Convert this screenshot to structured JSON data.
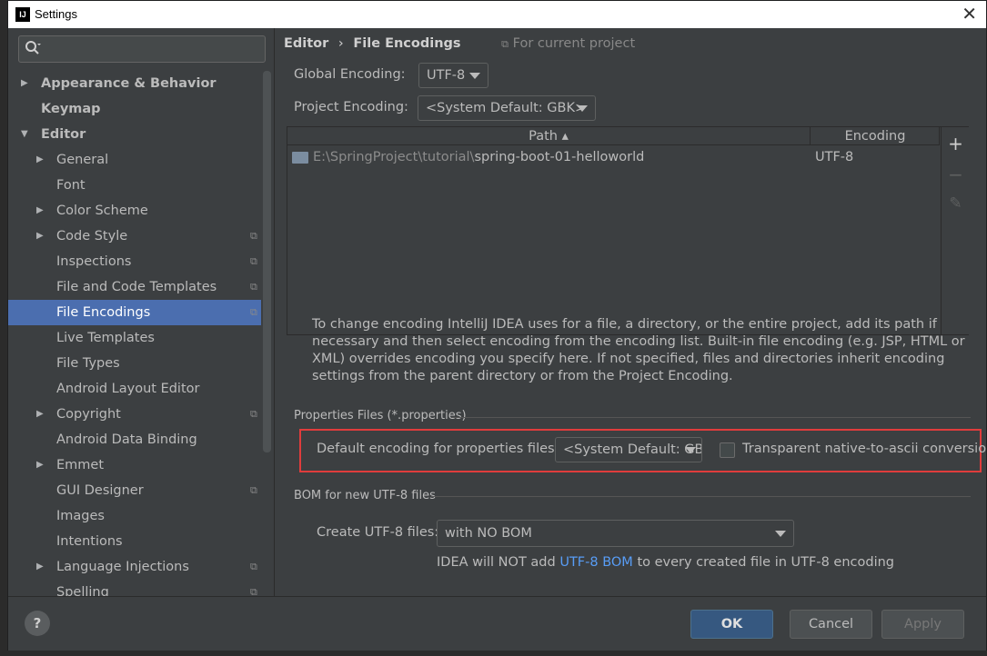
{
  "window": {
    "title": "Settings",
    "app_icon": "IJ",
    "close_glyph": "✕"
  },
  "sidebar": {
    "search_placeholder": "",
    "items": [
      {
        "label": "Appearance & Behavior",
        "arrow": "▶",
        "bold": true,
        "level": 0
      },
      {
        "label": "Keymap",
        "arrow": "",
        "bold": true,
        "level": 0
      },
      {
        "label": "Editor",
        "arrow": "▼",
        "bold": true,
        "level": 0
      },
      {
        "label": "General",
        "arrow": "▶",
        "level": 1
      },
      {
        "label": "Font",
        "arrow": "",
        "level": 1
      },
      {
        "label": "Color Scheme",
        "arrow": "▶",
        "level": 1
      },
      {
        "label": "Code Style",
        "arrow": "▶",
        "level": 1,
        "proj": true
      },
      {
        "label": "Inspections",
        "arrow": "",
        "level": 1,
        "proj": true
      },
      {
        "label": "File and Code Templates",
        "arrow": "",
        "level": 1,
        "proj": true
      },
      {
        "label": "File Encodings",
        "arrow": "",
        "level": 1,
        "proj": true,
        "selected": true
      },
      {
        "label": "Live Templates",
        "arrow": "",
        "level": 1
      },
      {
        "label": "File Types",
        "arrow": "",
        "level": 1
      },
      {
        "label": "Android Layout Editor",
        "arrow": "",
        "level": 1
      },
      {
        "label": "Copyright",
        "arrow": "▶",
        "level": 1,
        "proj": true
      },
      {
        "label": "Android Data Binding",
        "arrow": "",
        "level": 1
      },
      {
        "label": "Emmet",
        "arrow": "▶",
        "level": 1
      },
      {
        "label": "GUI Designer",
        "arrow": "",
        "level": 1,
        "proj": true
      },
      {
        "label": "Images",
        "arrow": "",
        "level": 1
      },
      {
        "label": "Intentions",
        "arrow": "",
        "level": 1
      },
      {
        "label": "Language Injections",
        "arrow": "▶",
        "level": 1,
        "proj": true
      },
      {
        "label": "Spelling",
        "arrow": "",
        "level": 1,
        "proj": true
      }
    ]
  },
  "breadcrumb": {
    "parent": "Editor",
    "sep": "›",
    "current": "File Encodings",
    "scope": "For current project"
  },
  "global_encoding": {
    "label": "Global Encoding:",
    "value": "UTF-8"
  },
  "project_encoding": {
    "label": "Project Encoding:",
    "value": "<System Default: GBK>"
  },
  "table": {
    "headers": [
      "Path ▴",
      "Encoding"
    ],
    "rows": [
      {
        "path_dim": "E:\\SpringProject\\tutorial\\",
        "path_main": "spring-boot-01-helloworld",
        "encoding": "UTF-8"
      }
    ],
    "tools": {
      "add": "+",
      "remove": "−",
      "edit": "✎"
    }
  },
  "description": "To change encoding IntelliJ IDEA uses for a file, a directory, or the entire project, add its path if necessary and then select encoding from the encoding list. Built-in file encoding (e.g. JSP, HTML or XML) overrides encoding you specify here. If not specified, files and directories inherit encoding settings from the parent directory or from the Project Encoding.",
  "properties_section": {
    "title": "Properties Files (*.properties)",
    "default_label": "Default encoding for properties files:",
    "default_value": "<System Default: GBK>",
    "transparent_label": "Transparent native-to-ascii conversion",
    "transparent_checked": false
  },
  "bom_section": {
    "title": "BOM for new UTF-8 files",
    "create_label": "Create UTF-8 files:",
    "create_value": "with NO BOM",
    "note_pre": "IDEA will NOT add",
    "note_link": "UTF-8 BOM",
    "note_post": "to every created file in UTF-8 encoding"
  },
  "footer": {
    "help": "?",
    "ok": "OK",
    "cancel": "Cancel",
    "apply": "Apply"
  },
  "colors": {
    "accent": "#4b6eaf",
    "highlight_box": "#e03c3c",
    "link": "#589df6"
  }
}
